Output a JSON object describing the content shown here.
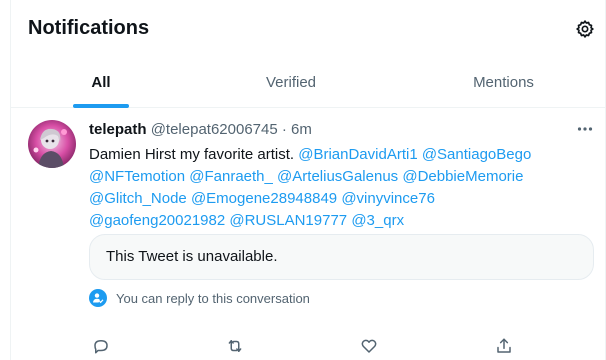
{
  "header": {
    "title": "Notifications",
    "settings_icon": "gear-icon"
  },
  "tabs": [
    {
      "label": "All",
      "active": true
    },
    {
      "label": "Verified",
      "active": false
    },
    {
      "label": "Mentions",
      "active": false
    }
  ],
  "colors": {
    "accent": "#1d9bf0",
    "text_primary": "#0f1419",
    "text_secondary": "#536471"
  },
  "tweet": {
    "author_name": "telepath",
    "author_handle": "@telepat62006745",
    "separator": "·",
    "time": "6m",
    "text_prefix": "Damien Hirst my favorite artist.",
    "mentions": [
      "@BrianDavidArti1",
      "@SantiagoBego",
      "@NFTemotion",
      "@Fanraeth_",
      "@ArteliusGalenus",
      "@DebbieMemorie",
      "@Glitch_Node",
      "@Emogene28948849",
      "@vinyvince76",
      "@gaofeng20021982",
      "@RUSLAN19777",
      "@3_qrx"
    ],
    "quote_unavailable": "This Tweet is unavailable.",
    "reply_note": "You can reply to this conversation",
    "actions": [
      "reply-icon",
      "retweet-icon",
      "like-icon",
      "share-icon"
    ]
  }
}
